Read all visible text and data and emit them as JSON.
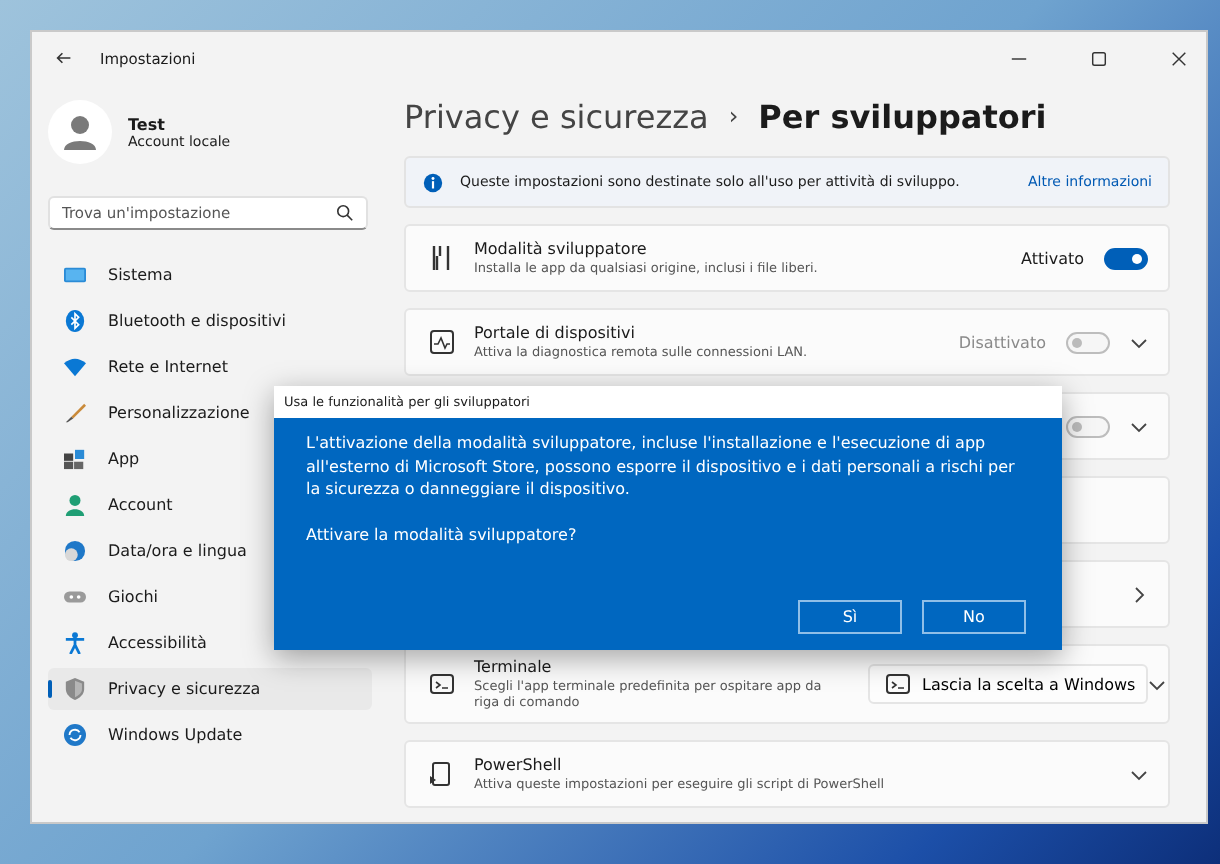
{
  "window": {
    "title": "Impostazioni"
  },
  "user": {
    "name": "Test",
    "account": "Account locale"
  },
  "search": {
    "placeholder": "Trova un'impostazione"
  },
  "sidebar": {
    "items": [
      {
        "label": "Sistema",
        "selected": false
      },
      {
        "label": "Bluetooth e dispositivi",
        "selected": false
      },
      {
        "label": "Rete e Internet",
        "selected": false
      },
      {
        "label": "Personalizzazione",
        "selected": false
      },
      {
        "label": "App",
        "selected": false
      },
      {
        "label": "Account",
        "selected": false
      },
      {
        "label": "Data/ora e lingua",
        "selected": false
      },
      {
        "label": "Giochi",
        "selected": false
      },
      {
        "label": "Accessibilità",
        "selected": false
      },
      {
        "label": "Privacy e sicurezza",
        "selected": true
      },
      {
        "label": "Windows Update",
        "selected": false
      }
    ]
  },
  "breadcrumb": {
    "parent": "Privacy e sicurezza",
    "separator": "›",
    "current": "Per sviluppatori"
  },
  "info_bar": {
    "text": "Queste impostazioni sono destinate solo all'uso per attività di sviluppo.",
    "link": "Altre informazioni"
  },
  "rows": [
    {
      "kind": "toggle",
      "title": "Modalità sviluppatore",
      "description": "Installa le app da qualsiasi origine, inclusi i file liberi.",
      "state_label": "Attivato",
      "on": true,
      "expandable": false
    },
    {
      "kind": "toggle",
      "title": "Portale di dispositivi",
      "description": "Attiva la diagnostica remota sulle connessioni LAN.",
      "state_label": "Disattivato",
      "on": false,
      "expandable": true
    },
    {
      "kind": "covered-toggle",
      "on": false,
      "expandable": true
    },
    {
      "kind": "covered"
    },
    {
      "kind": "covered-link"
    },
    {
      "kind": "dropdown",
      "title": "Terminale",
      "description": "Scegli l'app terminale predefinita per ospitare app da riga di comando",
      "value": "Lascia la scelta a Windows"
    },
    {
      "kind": "expander",
      "title": "PowerShell",
      "description": "Attiva queste impostazioni per eseguire gli script di PowerShell"
    }
  ],
  "dialog": {
    "title": "Usa le funzionalità per gli sviluppatori",
    "message": "L'attivazione della modalità sviluppatore, incluse l'installazione e l'esecuzione di app all'esterno di Microsoft Store, possono esporre il dispositivo e i dati personali a rischi per la sicurezza o danneggiare il dispositivo.",
    "question": "Attivare la modalità sviluppatore?",
    "buttons": [
      {
        "label": "Sì"
      },
      {
        "label": "No"
      }
    ]
  }
}
